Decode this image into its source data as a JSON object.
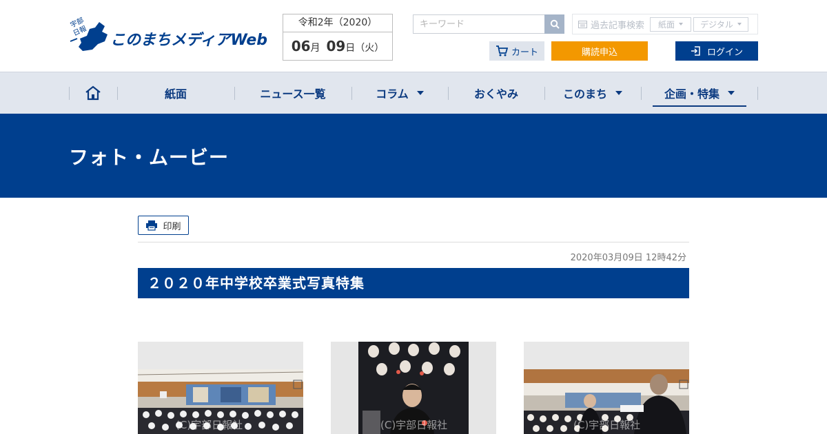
{
  "header": {
    "logo_badge": "宇部日報",
    "logo_text": "このまちメディアWeb",
    "date_era": "令和2年（2020）",
    "date_month": "06",
    "date_month_unit": "月",
    "date_day": "09",
    "date_day_unit": "日",
    "date_weekday": "（火）",
    "search_placeholder": "キーワード",
    "archive_label": "過去記事検索",
    "archive_options": [
      "紙面",
      "デジタル"
    ],
    "cart_label": "カート",
    "subscribe_label": "購読申込",
    "login_label": "ログイン"
  },
  "nav": {
    "items": [
      {
        "label": "紙面"
      },
      {
        "label": "ニュース一覧"
      },
      {
        "label": "コラム"
      },
      {
        "label": "おくやみ"
      },
      {
        "label": "このまち"
      },
      {
        "label": "企画・特集"
      }
    ]
  },
  "banner": {
    "title": "フォト・ムービー"
  },
  "article": {
    "print_label": "印刷",
    "timestamp": "2020年03月09日 12時42分",
    "title": "２０２０年中学校卒業式写真特集",
    "watermark": "(C)宇部日報社"
  },
  "colors": {
    "brand_blue": "#003f8e",
    "nav_bg": "#e1e6ee",
    "subscribe_orange": "#f39800"
  }
}
